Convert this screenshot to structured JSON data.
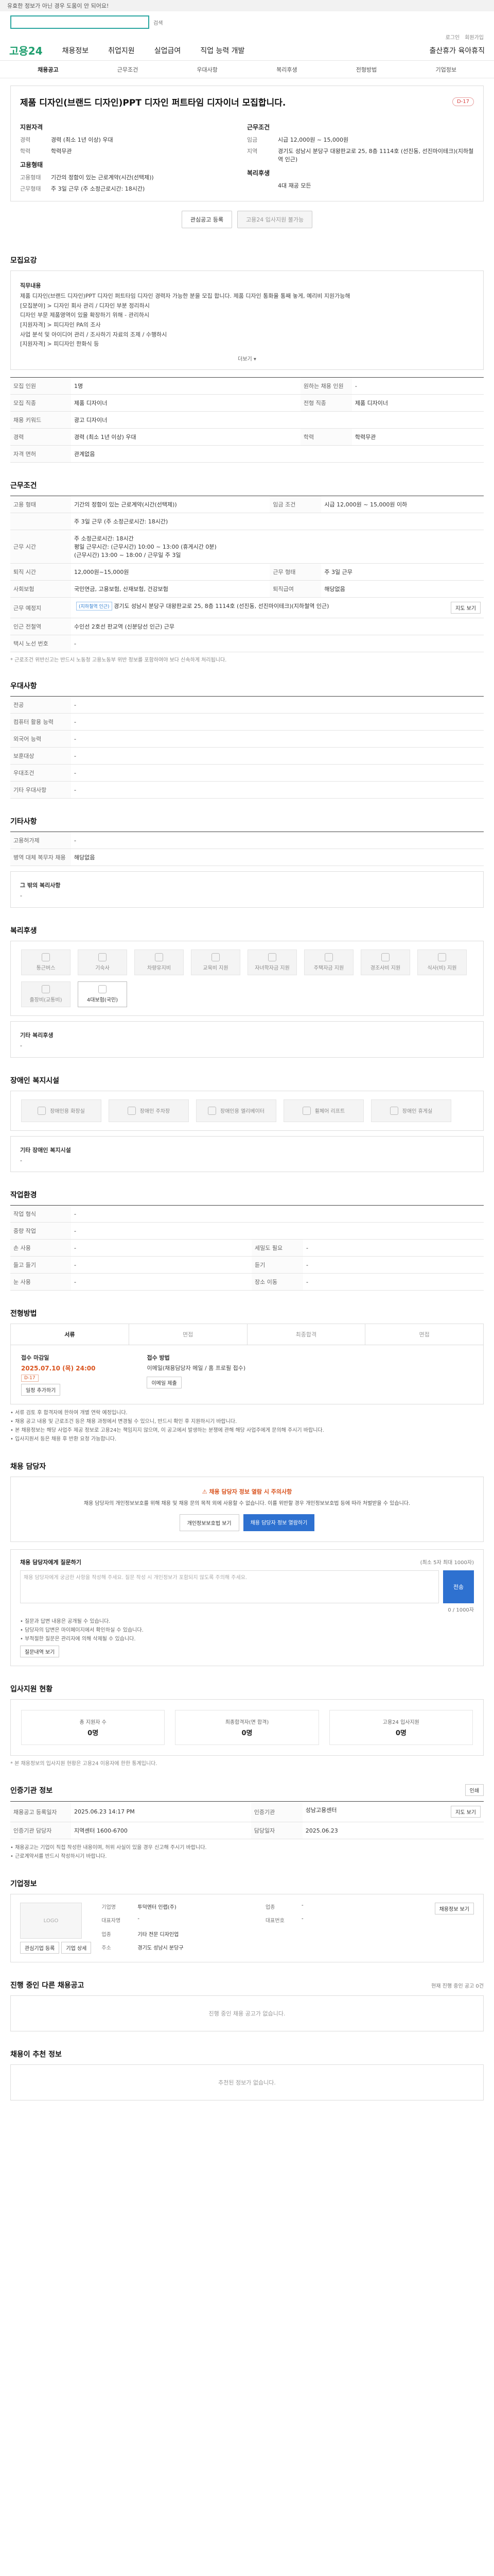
{
  "banner": {
    "text": "유효한 정보가 아닌 경우 도움이 안 되어요!"
  },
  "search": {
    "placeholder": "",
    "label": "검색"
  },
  "util": {
    "items": [
      "로그인",
      "회원가입"
    ]
  },
  "nav": {
    "logo": "고용24",
    "items": [
      "채용정보",
      "취업지원",
      "실업급여",
      "직업 능력 개발"
    ],
    "right": "출산휴가 육아휴직"
  },
  "subnav": [
    "채용공고",
    "근무조건",
    "우대사항",
    "복리후생",
    "전형방법",
    "기업정보"
  ],
  "job": {
    "title": "제품 디자인(브랜드 디자인)PPT 디자인 퍼트타임 디자이너 모집합니다.",
    "dday": "D-17",
    "left_head": "지원자격",
    "left": [
      {
        "k": "경력",
        "v": "경력 (최소 1년 이상) 우대"
      },
      {
        "k": "학력",
        "v": "학력무관"
      }
    ],
    "left_head2": "고용형태",
    "left2": [
      {
        "k": "고용형태",
        "v": "기간의 정함이 있는 근로계약(시간(선택제))"
      },
      {
        "k": "근무형태",
        "v": "주 3일 근무 (주 소정근로시간: 18시간)"
      }
    ],
    "right_head": "근무조건",
    "right": [
      {
        "k": "임금",
        "v": "시급 12,000원 ~ 15,000원"
      },
      {
        "k": "지역",
        "v": "경기도 성남시 분당구 대왕판교로 25, 8층 1114호 (선진동, 선진마이테크)(지하철역 인근)"
      }
    ],
    "right_head2": "복리후생",
    "right2": [
      {
        "k": "",
        "v": "4대 재공 모든"
      }
    ],
    "btn_scrap": "관심공고 등록",
    "btn_apply": "고용24 입사지원 불가능"
  },
  "recruit": {
    "title": "모집요강",
    "blocks": [
      {
        "h": "직무내용",
        "t": "제품 디자인(브랜드 디자인)PPT 디자인 퍼트타임 디자인 경력자 가능한 분을 모집 합니다. 제품 디자인 통화율 통째 놓게, 예리비 지원가능해"
      },
      {
        "h": "",
        "t": "[모집분야] > 디자인 회사 관리 / 디자인 부분 정리하시"
      },
      {
        "h": "",
        "t": "디자인 부문 제품영역이 있을 확장하기 위해 - 관리하시"
      },
      {
        "h": "",
        "t": "[지원자격] > 피디자인 PA의 조사"
      },
      {
        "h": "",
        "t": "사업 분석 및 아이디어 관리 / 조사하기 자료의 조제 / 수행하시"
      },
      {
        "h": "",
        "t": "[지원자격] > 피디자인 한화식 등"
      }
    ],
    "more": "더보기 ▾"
  },
  "recruit_table": [
    [
      "모집 인원",
      "1명",
      "원하는 채용 인원",
      "-"
    ],
    [
      "모집 직종",
      "제품 디자이너",
      "전형 직종",
      "제품 디자이너"
    ],
    [
      "채용 키워드",
      "광고 디자이너",
      "",
      ""
    ],
    [
      "경력",
      "경력 (최소 1년 이상) 우대",
      "학력",
      "학력무관"
    ],
    [
      "자격 면허",
      "관계없음",
      "",
      ""
    ]
  ],
  "conditions": {
    "title": "근무조건",
    "rows": [
      [
        "고용 형태",
        "기간의 정함이 있는 근로계약(시간(선택제))",
        "임금 조건",
        "시급 12,000원 ~ 15,000원 이하"
      ],
      [
        "",
        "주 3일 근무 (주 소정근로시간: 18시간)",
        "",
        ""
      ],
      [
        "근무 시간",
        "주 소정근로시간: 18시간",
        "",
        ""
      ],
      [
        "",
        "평일 근무시간: (근무시간) 10:00 ~ 13:00 (휴게시간 0분)",
        "",
        ""
      ],
      [
        "",
        "(근무시간) 13:00 ~ 18:00 / 근무일 주 3일",
        "",
        ""
      ],
      [
        "퇴직 시간",
        "12,000원~15,000원",
        "근무 형태",
        "주 3일 근무"
      ],
      [
        "사회보험",
        "국민연금, 고용보험, 산재보험, 건강보험",
        "퇴직급여",
        "해당없음"
      ],
      [
        "근무 예정지",
        "경기도 성남시 분당구 대왕판교로 25, 8층 1114호 (선진동, 선진마이테크)(지하철역 인근)",
        "",
        ""
      ],
      [
        "인근 전철역",
        "수인선 2호선 판교역 (신분당선 인근) 근무",
        "",
        ""
      ],
      [
        "택시 노선 번호",
        "-",
        "",
        ""
      ]
    ],
    "map_btn": "지도 보기",
    "subway_tag": "(지하철역 인근)",
    "note": "* 근로조건 위반신고는 반드시 노동청 고용노동부 위반 정보를 포함하여야 보다 신속하게 처리됩니다."
  },
  "preference": {
    "title": "우대사항",
    "rows": [
      [
        "전공",
        "-"
      ],
      [
        "컴퓨터 활용 능력",
        "-"
      ],
      [
        "외국어 능력",
        "-"
      ],
      [
        "보훈대상",
        "-"
      ],
      [
        "우대조건",
        "-"
      ],
      [
        "기타 우대사항",
        "-"
      ]
    ]
  },
  "etc": {
    "title": "기타사항",
    "rows": [
      [
        "고용허가제",
        "-"
      ],
      [
        "병역 대체 복무자 채용",
        "해당없음"
      ]
    ],
    "sub_h": "그 밖의 복리사항",
    "sub_t": "-"
  },
  "welfare": {
    "title": "복리후생",
    "items": [
      "통근버스",
      "기숙사",
      "차량유지비",
      "교육비 지원",
      "자녀학자금 지원",
      "주택자금 지원",
      "경조사비 지원",
      "식사(비) 지원",
      "출장비(교통비)",
      "4대보험(국민)"
    ],
    "sub_h": "기타 복리후생",
    "sub_t": "-"
  },
  "disability": {
    "title": "장애인 복지시설",
    "items": [
      "장애인용 화장실",
      "장애인 주차장",
      "장애인용 엘리베이터",
      "휠체어 리프트",
      "장애인 휴게실"
    ],
    "sub_h": "기타 장애인 복지시설",
    "sub_t": "-"
  },
  "environment": {
    "title": "작업환경",
    "rows": [
      [
        "작업 형식",
        "-",
        "",
        ""
      ],
      [
        "중량 작업",
        "-",
        "",
        ""
      ],
      [
        "손 사용",
        "-",
        "세밀도 필요",
        "-"
      ],
      [
        "들고 들기",
        "-",
        "듣기",
        "-"
      ],
      [
        "눈 사용",
        "-",
        "장소 이동",
        "-"
      ]
    ]
  },
  "process": {
    "title": "전형방법",
    "tabs": [
      "서류",
      "면접",
      "최종합격",
      "면접"
    ],
    "deadline_h": "접수 마감일",
    "deadline": "2025.07.10 (목) 24:00",
    "deadline_badge": "D-17",
    "cal_btn": "일정 추가하기",
    "method_h": "접수 방법",
    "method": "이메일(채용담당자 메일 / 홈 프로필 접수)",
    "method_btn": "이메일 제출",
    "notes": [
      "서류 검토 후 합격자에 한하여 개별 연락 예정입니다.",
      "채용 공고 내용 및 근로조건 등은 채용 과정에서 변경될 수 있으니, 반드시 확인 후 지원하시기 바랍니다.",
      "본 채용정보는 해당 사업주 제공 정보로 고용24는 책임지지 않으며, 이 공고에서 발생하는 분쟁에 관해 해당 사업주에게 문의해 주시기 바랍니다.",
      "입사지원서 등은 채용 후 반환 요청 가능합니다."
    ]
  },
  "contact": {
    "title": "채용 담당자",
    "alert_t": "채용 담당자 정보 열람 시 주의사항",
    "alert_d": "채용 담당자의 개인정보보호를 위해 채용 및 채용 문의 목적 외에 사용할 수 없습니다. 이를 위반할 경우 개인정보보호법 등에 따라 처벌받을 수 있습니다.",
    "btn1": "개인정보보호법 보기",
    "btn2": "채용 담당자 정보 열람하기"
  },
  "question": {
    "title": "채용 담당자에게 질문하기",
    "counter": "(최소 5자 최대 1000자)",
    "placeholder": "채용 담당자에게 궁금한 사항을 작성해 주세요. 질문 작성 시 개인정보가 포함되지 않도록 주의해 주세요.",
    "send": "전송",
    "count": "0 / 1000자",
    "notes": [
      "질문과 답변 내용은 공개될 수 있습니다.",
      "담당자의 답변은 마이페이지에서 확인하실 수 있습니다.",
      "부적절한 질문은 관리자에 의해 삭제될 수 있습니다."
    ],
    "btn": "질문내역 보기"
  },
  "apply_stats": {
    "title": "입사지원 현황",
    "items": [
      {
        "l": "총 지원자 수",
        "n": "0명"
      },
      {
        "l": "최종합격자(면 합격)",
        "n": "0명"
      },
      {
        "l": "고용24 입사지원",
        "n": "0명"
      }
    ],
    "note": "* 본 채용정보의 입사지원 현황은 고용24 이용자에 한한 통계입니다."
  },
  "agency": {
    "title": "인증기관 정보",
    "print": "인쇄",
    "rows": [
      [
        "채용공고 등록일자",
        "2025.06.23 14:17 PM",
        "인증기관",
        "성남고용센터"
      ],
      [
        "인증기관 담당자",
        "지역센터 1600-6700",
        "담당일자",
        "2025.06.23"
      ]
    ],
    "view_btn": "지도 보기",
    "notes": [
      "채용공고는 기업이 직접 작성한 내용이며, 허위 사실이 있을 경우 신고해 주시기 바랍니다.",
      "근로계약서를 반드시 작성하시기 바랍니다."
    ]
  },
  "company": {
    "title": "기업정보",
    "logo_alt": "LOGO",
    "rows": [
      [
        "기업명",
        "투덕엔터 인랩(주)",
        "업종",
        "-"
      ],
      [
        "대표자명",
        "-",
        "대표번호",
        "-"
      ],
      [
        "업종",
        "기타 전문 디자인업",
        "",
        ""
      ],
      [
        "주소",
        "경기도 성남시 분당구",
        "",
        ""
      ]
    ],
    "btn": "채용정보 보기",
    "sub_btns": [
      "관심기업 등록",
      "기업 상세"
    ]
  },
  "related": {
    "title": "진행 중인 다른 채용공고",
    "right": "현재 진행 중인 공고 0건",
    "empty": "진행 중인 채용 공고가 없습니다."
  },
  "recommend": {
    "title": "채용이 추천 정보",
    "empty": "추천된 정보가 없습니다."
  }
}
